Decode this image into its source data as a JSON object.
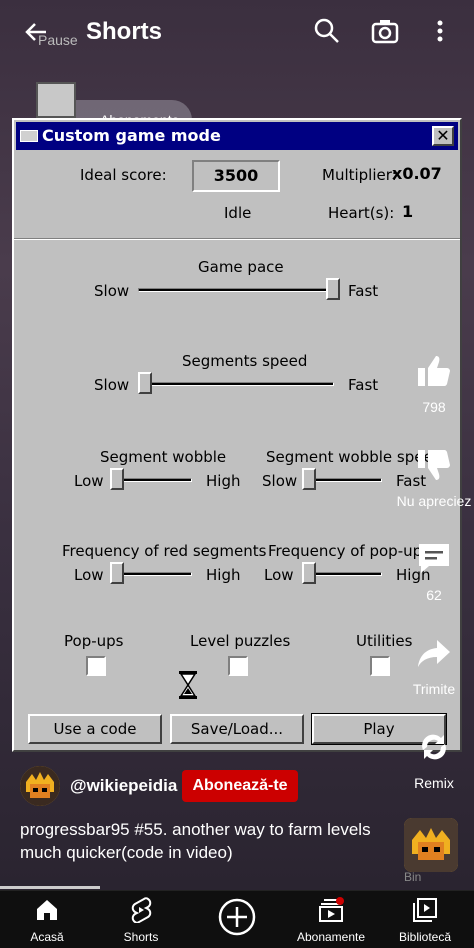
{
  "header": {
    "title": "Shorts",
    "overlay_text": "Pause",
    "chip_label": "Abonamente",
    "icons": [
      "back-arrow-icon",
      "search-icon",
      "camera-icon",
      "more-vert-icon"
    ]
  },
  "dialog": {
    "title": "Custom game mode",
    "close_label": "✕",
    "ideal_score_label": "Ideal score:",
    "ideal_score_value": "3500",
    "multiplier_label": "Multiplier:",
    "multiplier_value": "x0.07",
    "state": "Idle",
    "hearts_label": "Heart(s):",
    "hearts_value": "1",
    "sliders": [
      {
        "label": "Game pace",
        "min_label": "Slow",
        "max_label": "Fast",
        "level": 1.0
      },
      {
        "label": "Segments speed",
        "min_label": "Slow",
        "max_label": "Fast",
        "level": 0.0
      },
      {
        "label": "Segment wobble",
        "min_label": "Low",
        "max_label": "High",
        "level": 0.0
      },
      {
        "label": "Segment wobble speed",
        "min_label": "Slow",
        "max_label": "Fast",
        "level": 0.0
      },
      {
        "label": "Frequency of red segments",
        "min_label": "Low",
        "max_label": "High",
        "level": 0.0
      },
      {
        "label": "Frequency of pop-ups",
        "min_label": "Low",
        "max_label": "High",
        "level": 0.0
      }
    ],
    "checkboxes": [
      {
        "label": "Pop-ups",
        "checked": false
      },
      {
        "label": "Level puzzles",
        "checked": false
      },
      {
        "label": "Utilities",
        "checked": false
      }
    ],
    "buttons": {
      "code": "Use a code",
      "save": "Save/Load...",
      "play": "Play"
    }
  },
  "actions": {
    "like_count": "798",
    "dislike_label": "Nu apreciez",
    "comments_count": "62",
    "share_label": "Trimite",
    "remix_label": "Remix"
  },
  "video": {
    "channel": "@wikiepeidia",
    "subscribe_label": "Abonează-te",
    "description": "progressbar95 #55. another way to farm levels much quicker(code in video)",
    "bin_label": "Bin"
  },
  "nav": [
    {
      "label": "Acasă",
      "icon": "home-icon"
    },
    {
      "label": "Shorts",
      "icon": "shorts-icon"
    },
    {
      "label": "",
      "icon": "create-icon"
    },
    {
      "label": "Abonamente",
      "icon": "subscriptions-icon"
    },
    {
      "label": "Bibliotecă",
      "icon": "library-icon"
    }
  ],
  "colors": {
    "accent": "#cc0000",
    "win_title": "#000082",
    "win_face": "#c0c0c0"
  }
}
